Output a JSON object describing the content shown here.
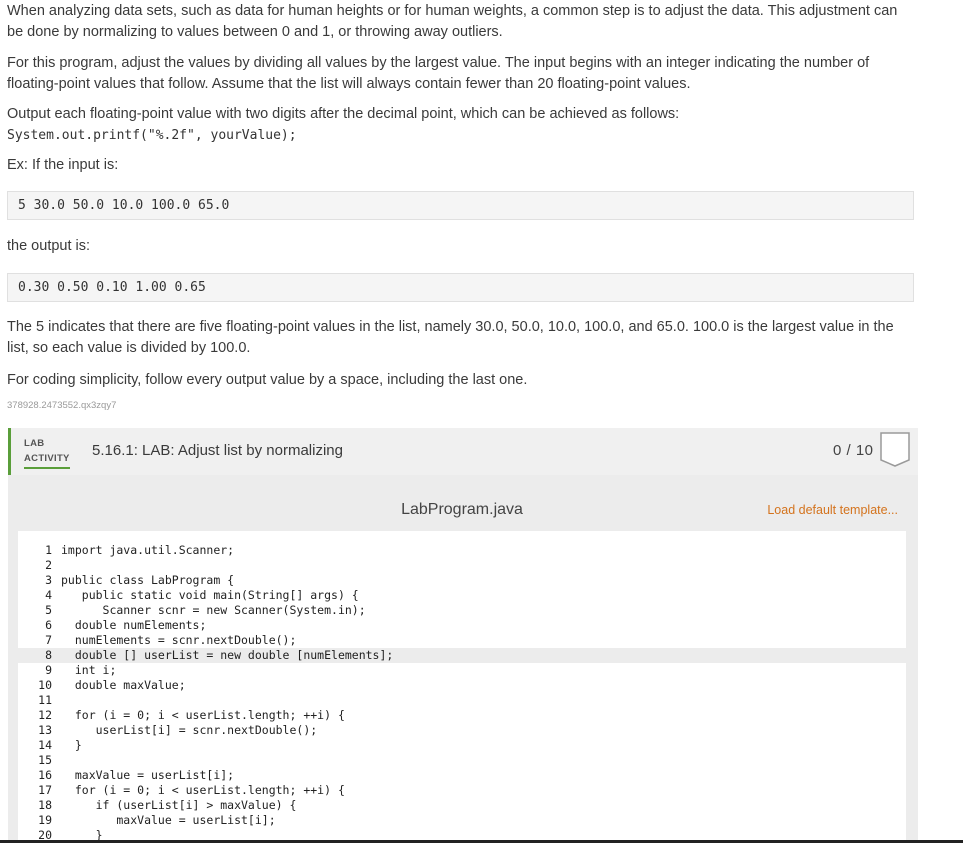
{
  "prose": {
    "p1": "When analyzing data sets, such as data for human heights or for human weights, a common step is to adjust the data. This adjustment can be done by normalizing to values between 0 and 1, or throwing away outliers.",
    "p2": "For this program, adjust the values by dividing all values by the largest value. The input begins with an integer indicating the number of floating-point values that follow. Assume that the list will always contain fewer than 20 floating-point values.",
    "p3": "Output each floating-point value with two digits after the decimal point, which can be achieved as follows:",
    "p3_code": "System.out.printf(\"%.2f\", yourValue);",
    "p4": "Ex: If the input is:",
    "input_sample": "5 30.0 50.0 10.0 100.0 65.0",
    "p5": "the output is:",
    "output_sample": "0.30 0.50 0.10 1.00 0.65",
    "p6": "The 5 indicates that there are five floating-point values in the list, namely 30.0, 50.0, 10.0, 100.0, and 65.0. 100.0 is the largest value in the list, so each value is divided by 100.0.",
    "p7": "For coding simplicity, follow every output value by a space, including the last one.",
    "id_text": "378928.2473552.qx3zqy7"
  },
  "lab": {
    "tag_line1": "LAB",
    "tag_line2": "ACTIVITY",
    "title": "5.16.1: LAB: Adjust list by normalizing",
    "score": "0 / 10"
  },
  "editor": {
    "filename": "LabProgram.java",
    "load_label": "Load default template...",
    "highlighted_line": 8,
    "lines": [
      {
        "n": "1",
        "t": "import java.util.Scanner;"
      },
      {
        "n": "2",
        "t": ""
      },
      {
        "n": "3",
        "t": "public class LabProgram {"
      },
      {
        "n": "4",
        "t": "   public static void main(String[] args) {"
      },
      {
        "n": "5",
        "t": "      Scanner scnr = new Scanner(System.in);"
      },
      {
        "n": "6",
        "t": "  double numElements;"
      },
      {
        "n": "7",
        "t": "  numElements = scnr.nextDouble();"
      },
      {
        "n": "8",
        "t": "  double [] userList = new double [numElements];"
      },
      {
        "n": "9",
        "t": "  int i;"
      },
      {
        "n": "10",
        "t": "  double maxValue;"
      },
      {
        "n": "11",
        "t": ""
      },
      {
        "n": "12",
        "t": "  for (i = 0; i < userList.length; ++i) {"
      },
      {
        "n": "13",
        "t": "     userList[i] = scnr.nextDouble();"
      },
      {
        "n": "14",
        "t": "  }"
      },
      {
        "n": "15",
        "t": ""
      },
      {
        "n": "16",
        "t": "  maxValue = userList[i];"
      },
      {
        "n": "17",
        "t": "  for (i = 0; i < userList.length; ++i) {"
      },
      {
        "n": "18",
        "t": "     if (userList[i] > maxValue) {"
      },
      {
        "n": "19",
        "t": "        maxValue = userList[i];"
      },
      {
        "n": "20",
        "t": "     }"
      }
    ]
  },
  "colors": {
    "accent_green": "#5a9e3a",
    "link_orange": "#d4731d"
  }
}
